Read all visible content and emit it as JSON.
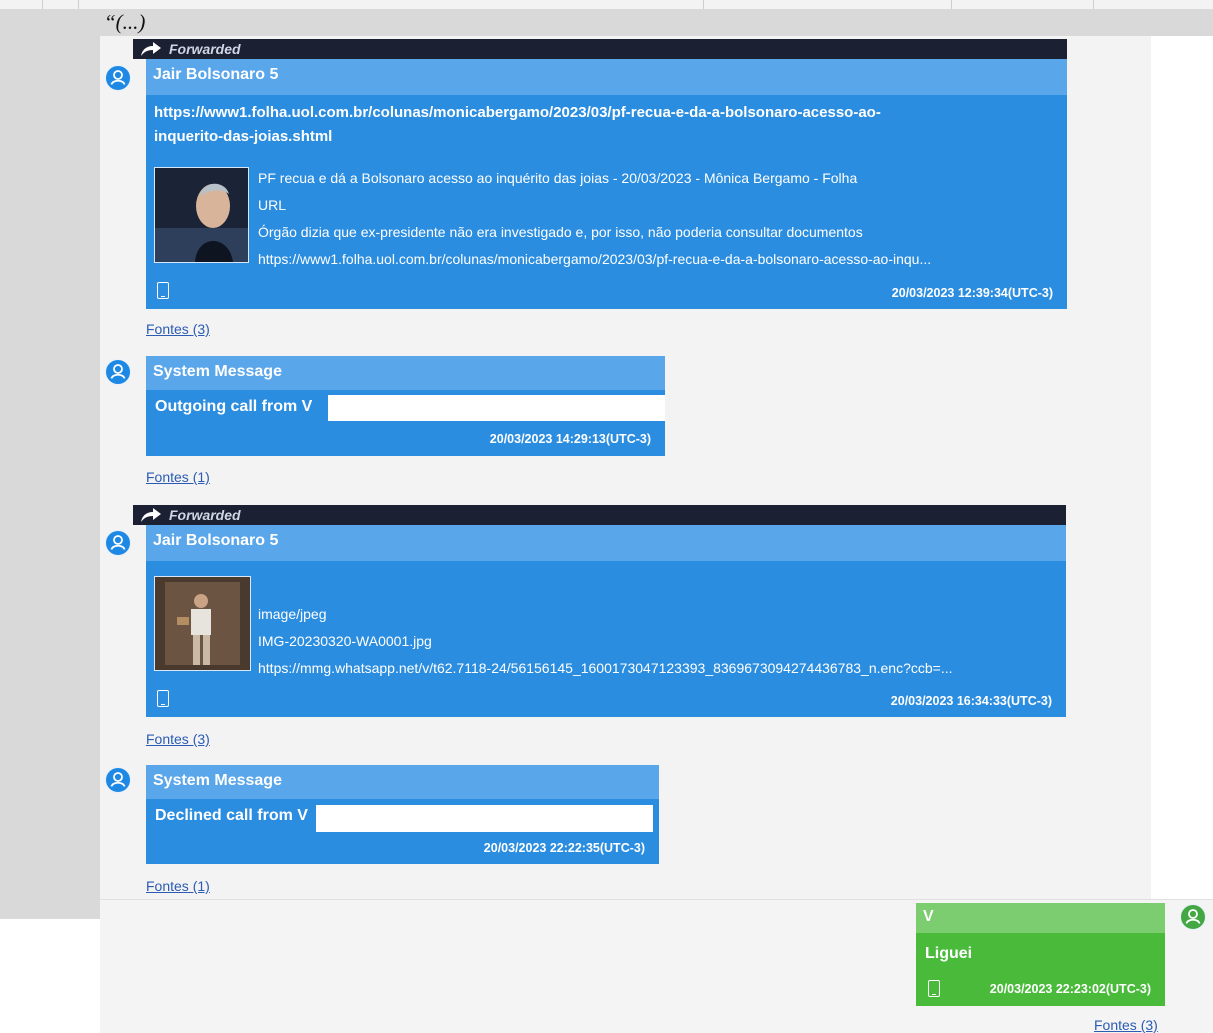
{
  "quote_prefix": "“(...)",
  "messages": [
    {
      "forwarded_label": "Forwarded",
      "sender": "Jair Bolsonaro 5",
      "link_title": "https://www1.folha.uol.com.br/colunas/monicabergamo/2023/03/pf-recua-e-da-a-bolsonaro-acesso-ao-inquerito-das-joias.shtml",
      "link_title_line1": "https://www1.folha.uol.com.br/colunas/monicabergamo/2023/03/pf-recua-e-da-a-bolsonaro-acesso-ao-",
      "link_title_line2": "inquerito-das-joias.shtml",
      "preview_title": "PF recua e dá a Bolsonaro acesso ao inquérito das joias - 20/03/2023 - Mônica Bergamo - Folha",
      "preview_type": "URL",
      "preview_description": "Órgão dizia que ex-presidente não era investigado e, por isso, não poderia consultar documentos",
      "preview_url": "https://www1.folha.uol.com.br/colunas/monicabergamo/2023/03/pf-recua-e-da-a-bolsonaro-acesso-ao-inqu...",
      "timestamp": "20/03/2023 12:39:34(UTC-3)",
      "sources": "Fontes (3)"
    },
    {
      "sender": "System Message",
      "text": "Outgoing call from V",
      "timestamp": "20/03/2023 14:29:13(UTC-3)",
      "sources": "Fontes (1)"
    },
    {
      "forwarded_label": "Forwarded",
      "sender": "Jair Bolsonaro 5",
      "mime": "image/jpeg",
      "filename": "IMG-20230320-WA0001.jpg",
      "url": "https://mmg.whatsapp.net/v/t62.7118-24/56156145_1600173047123393_8369673094274436783_n.enc?ccb=...",
      "timestamp": "20/03/2023 16:34:33(UTC-3)",
      "sources": "Fontes (3)"
    },
    {
      "sender": "System Message",
      "text": "Declined call from V",
      "timestamp": "20/03/2023 22:22:35(UTC-3)",
      "sources": "Fontes (1)"
    },
    {
      "sender": "V",
      "text": "Liguei",
      "timestamp": "20/03/2023 22:23:02(UTC-3)",
      "sources": "Fontes (3)"
    }
  ],
  "colors": {
    "incoming_bubble": "#2b8de0",
    "incoming_header": "#5aa6ea",
    "outgoing_bubble": "#4aba3b",
    "forwarded_bar": "#1b2033",
    "link": "#2b5bb3"
  },
  "icons": {
    "avatar": "user-avatar-icon",
    "forwarded": "forward-arrow-icon",
    "device": "phone-icon"
  }
}
